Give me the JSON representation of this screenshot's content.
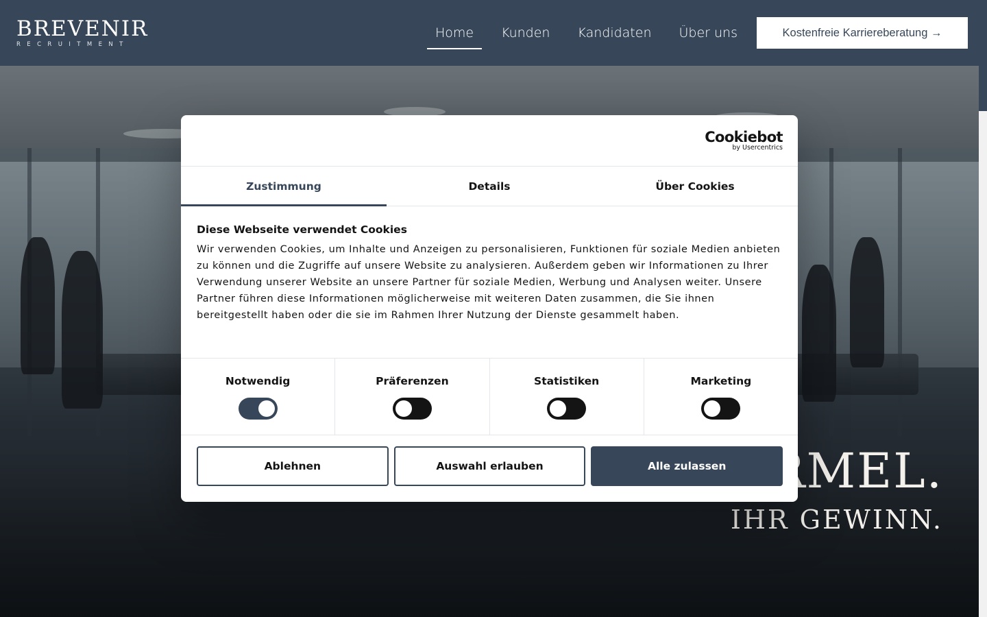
{
  "site": {
    "logo_main": "BREVENIR",
    "logo_sub": "RECRUITMENT",
    "nav": [
      {
        "label": "Home",
        "active": true
      },
      {
        "label": "Kunden",
        "active": false
      },
      {
        "label": "Kandidaten",
        "active": false
      },
      {
        "label": "Über uns",
        "active": false
      }
    ],
    "cta_label": "Kostenfreie Karriereberatung →"
  },
  "hero": {
    "headline_visible": "ORMEL.",
    "subline": "IHR GEWINN."
  },
  "cookie_dialog": {
    "brand_name": "Cookiebot",
    "brand_by": "by Usercentrics",
    "tabs": [
      {
        "label": "Zustimmung",
        "active": true
      },
      {
        "label": "Details",
        "active": false
      },
      {
        "label": "Über Cookies",
        "active": false
      }
    ],
    "title": "Diese Webseite verwendet Cookies",
    "body": "Wir verwenden Cookies, um Inhalte und Anzeigen zu personalisieren, Funktionen für soziale Medien anbieten zu können und die Zugriffe auf unsere Website zu analysieren. Außerdem geben wir Informationen zu Ihrer Verwendung unserer Website an unsere Partner für soziale Medien, Werbung und Analysen weiter. Unsere Partner führen diese Informationen möglicherweise mit weiteren Daten zusammen, die Sie ihnen bereitgestellt haben oder die sie im Rahmen Ihrer Nutzung der Dienste gesammelt haben.",
    "toggles": [
      {
        "label": "Notwendig",
        "checked": true
      },
      {
        "label": "Präferenzen",
        "checked": false
      },
      {
        "label": "Statistiken",
        "checked": false
      },
      {
        "label": "Marketing",
        "checked": false
      }
    ],
    "buttons": {
      "decline": "Ablehnen",
      "allow_selection": "Auswahl erlauben",
      "allow_all": "Alle zulassen"
    }
  },
  "colors": {
    "brand_navy": "#374759",
    "text": "#141414",
    "white": "#ffffff"
  }
}
